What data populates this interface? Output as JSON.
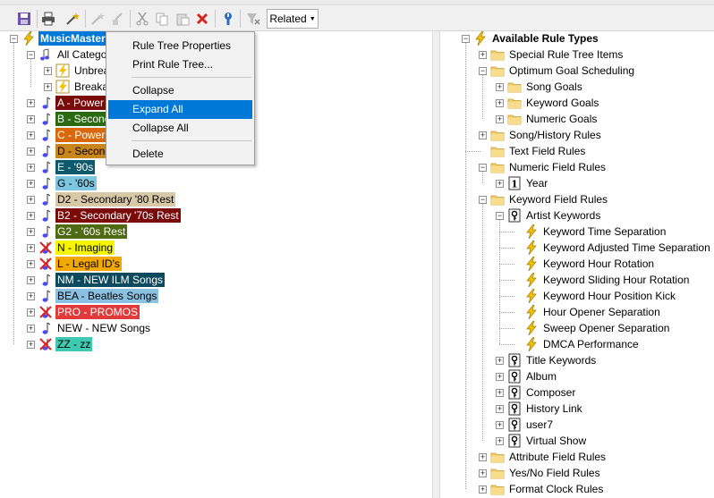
{
  "toolbar": {
    "related_label": "Related",
    "icons": [
      "save-icon",
      "print-icon",
      "magic-wand-icon",
      "wand-disabled-icon",
      "brush-disabled-icon",
      "cut-icon",
      "copy-icon",
      "paste-icon",
      "delete-icon",
      "wrench-icon",
      "filter-clear-icon"
    ]
  },
  "context_menu": {
    "items": [
      "Rule Tree Properties",
      "Print Rule Tree...",
      "Collapse",
      "Expand All",
      "Collapse All",
      "Delete"
    ],
    "highlighted": "Expand All",
    "highlight_color": "#0078d7"
  },
  "left_tree": {
    "root": "MusicMaster",
    "root_highlight": "#0078d7",
    "all_categories": "All Catego",
    "sub_items": [
      "Unbrea",
      "Breaka"
    ],
    "categories": [
      {
        "label": "A - Power",
        "bg": "#7b0a0a",
        "fg": "#ffffff",
        "icon": "note"
      },
      {
        "label": "B - Second",
        "bg": "#2b6a12",
        "fg": "#ffffff",
        "icon": "note"
      },
      {
        "label": "C - Power",
        "bg": "#d9680a",
        "fg": "#ffffff",
        "icon": "note"
      },
      {
        "label": "D - Second",
        "bg": "#c9861c",
        "fg": "#000000",
        "icon": "note"
      },
      {
        "label": "E - '90s",
        "bg": "#0d5a6e",
        "fg": "#ffffff",
        "icon": "note"
      },
      {
        "label": "G - '60s",
        "bg": "#7ec5e0",
        "fg": "#000000",
        "icon": "note"
      },
      {
        "label": "D2 - Secondary '80 Rest",
        "bg": "#d8c8a8",
        "fg": "#000000",
        "icon": "note"
      },
      {
        "label": "B2 - Secondary '70s Rest",
        "bg": "#7b0a0a",
        "fg": "#ffffff",
        "icon": "note"
      },
      {
        "label": "G2 - '60s Rest",
        "bg": "#4e6a12",
        "fg": "#ffffff",
        "icon": "note"
      },
      {
        "label": "N - Imaging",
        "bg": "#f5f500",
        "fg": "#000000",
        "icon": "no-note"
      },
      {
        "label": "L - Legal ID's",
        "bg": "#f2a800",
        "fg": "#000000",
        "icon": "no-note"
      },
      {
        "label": "NM - NEW ILM Songs",
        "bg": "#0d4a5e",
        "fg": "#ffffff",
        "icon": "note"
      },
      {
        "label": "BEA - Beatles Songs",
        "bg": "#8ac0e0",
        "fg": "#000000",
        "icon": "note"
      },
      {
        "label": "PRO - PROMOS",
        "bg": "#e03a3a",
        "fg": "#ffffff",
        "icon": "no-note"
      },
      {
        "label": "NEW - NEW Songs",
        "bg": "",
        "fg": "#000000",
        "icon": "note"
      },
      {
        "label": "ZZ - zz",
        "bg": "#3ec9b0",
        "fg": "#000000",
        "icon": "no-note"
      }
    ]
  },
  "right_tree": {
    "rows": [
      {
        "label": "Available Rule Types",
        "level": 0,
        "exp": "-",
        "icon": "bolt",
        "bold": true
      },
      {
        "label": "Special Rule Tree Items",
        "level": 1,
        "exp": "+",
        "icon": "folder"
      },
      {
        "label": "Optimum Goal Scheduling",
        "level": 1,
        "exp": "-",
        "icon": "folder"
      },
      {
        "label": "Song Goals",
        "level": 2,
        "exp": "+",
        "icon": "folder"
      },
      {
        "label": "Keyword Goals",
        "level": 2,
        "exp": "+",
        "icon": "folder"
      },
      {
        "label": "Numeric Goals",
        "level": 2,
        "exp": "+",
        "icon": "folder"
      },
      {
        "label": "Song/History Rules",
        "level": 1,
        "exp": "+",
        "icon": "folder"
      },
      {
        "label": "Text Field Rules",
        "level": 1,
        "exp": "",
        "icon": "folder"
      },
      {
        "label": "Numeric Field Rules",
        "level": 1,
        "exp": "-",
        "icon": "folder"
      },
      {
        "label": "Year",
        "level": 2,
        "exp": "+",
        "icon": "numeric"
      },
      {
        "label": "Keyword Field Rules",
        "level": 1,
        "exp": "-",
        "icon": "folder"
      },
      {
        "label": "Artist Keywords",
        "level": 2,
        "exp": "-",
        "icon": "keyword"
      },
      {
        "label": "Keyword Time Separation",
        "level": 3,
        "exp": "",
        "icon": "bolt"
      },
      {
        "label": "Keyword Adjusted Time Separation",
        "level": 3,
        "exp": "",
        "icon": "bolt"
      },
      {
        "label": "Keyword Hour Rotation",
        "level": 3,
        "exp": "",
        "icon": "bolt"
      },
      {
        "label": "Keyword Sliding Hour Rotation",
        "level": 3,
        "exp": "",
        "icon": "bolt"
      },
      {
        "label": "Keyword Hour Position Kick",
        "level": 3,
        "exp": "",
        "icon": "bolt"
      },
      {
        "label": "Hour Opener Separation",
        "level": 3,
        "exp": "",
        "icon": "bolt"
      },
      {
        "label": "Sweep Opener Separation",
        "level": 3,
        "exp": "",
        "icon": "bolt"
      },
      {
        "label": "DMCA Performance",
        "level": 3,
        "exp": "",
        "icon": "bolt"
      },
      {
        "label": "Title Keywords",
        "level": 2,
        "exp": "+",
        "icon": "keyword"
      },
      {
        "label": "Album",
        "level": 2,
        "exp": "+",
        "icon": "keyword"
      },
      {
        "label": "Composer",
        "level": 2,
        "exp": "+",
        "icon": "keyword"
      },
      {
        "label": "History Link",
        "level": 2,
        "exp": "+",
        "icon": "keyword"
      },
      {
        "label": "user7",
        "level": 2,
        "exp": "+",
        "icon": "keyword"
      },
      {
        "label": "Virtual Show",
        "level": 2,
        "exp": "+",
        "icon": "keyword"
      },
      {
        "label": "Attribute Field Rules",
        "level": 1,
        "exp": "+",
        "icon": "folder"
      },
      {
        "label": "Yes/No Field Rules",
        "level": 1,
        "exp": "+",
        "icon": "folder"
      },
      {
        "label": "Format Clock Rules",
        "level": 1,
        "exp": "+",
        "icon": "folder"
      }
    ]
  }
}
